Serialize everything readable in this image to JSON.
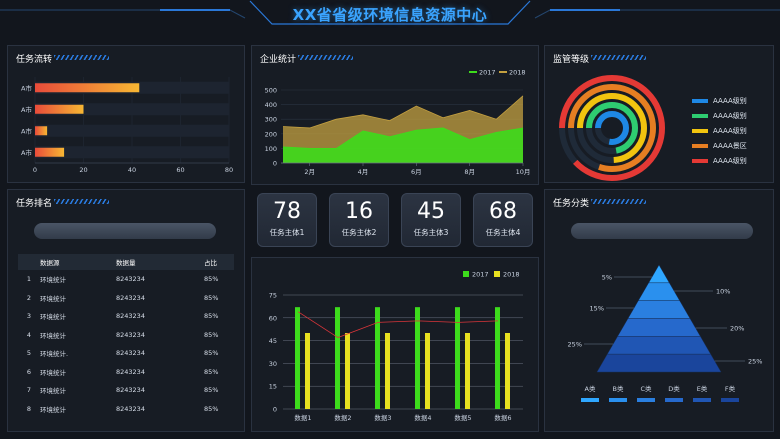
{
  "header": {
    "title": "XX省省级环境信息资源中心"
  },
  "task_flow": {
    "title": "任务流转",
    "chart_data": {
      "type": "bar",
      "orientation": "horizontal",
      "categories": [
        "A市",
        "A市",
        "A市",
        "A市"
      ],
      "values": [
        43,
        20,
        5,
        12
      ],
      "xlim": [
        0,
        80
      ],
      "xticks": [
        "0",
        "20",
        "40",
        "60",
        "80"
      ]
    }
  },
  "enterprise_stats": {
    "title": "企业统计",
    "chart_data": {
      "type": "area",
      "x": [
        "2月",
        "4月",
        "6月",
        "8月",
        "10月"
      ],
      "ylim": [
        0,
        500
      ],
      "yticks": [
        "0",
        "100",
        "200",
        "300",
        "400",
        "500"
      ],
      "series": [
        {
          "name": "2017",
          "color": "#3ddc1c",
          "values": [
            110,
            100,
            100,
            220,
            180,
            225,
            240,
            160,
            210,
            240
          ]
        },
        {
          "name": "2018",
          "color": "#c4a040",
          "values": [
            250,
            240,
            300,
            330,
            290,
            390,
            310,
            360,
            300,
            460
          ]
        }
      ]
    }
  },
  "supervision_level": {
    "title": "监管等级",
    "chart_data": {
      "type": "radial",
      "series": [
        {
          "name": "AAAA级别",
          "color": "#1e88e5",
          "value": 0.78
        },
        {
          "name": "AAAA级别",
          "color": "#2ecc71",
          "value": 0.72
        },
        {
          "name": "AAAA级别",
          "color": "#f1c40f",
          "value": 0.74
        },
        {
          "name": "AAAA景区",
          "color": "#e67e22",
          "value": 0.8
        },
        {
          "name": "AAAA级别",
          "color": "#e53935",
          "value": 0.88
        }
      ]
    }
  },
  "task_rank": {
    "title": "任务排名",
    "columns": [
      "",
      "数据源",
      "数据量",
      "占比"
    ],
    "rows": [
      [
        "1",
        "环境统计",
        "8243234",
        "85%"
      ],
      [
        "2",
        "环境统计",
        "8243234",
        "85%"
      ],
      [
        "3",
        "环境统计",
        "8243234",
        "85%"
      ],
      [
        "4",
        "环境统计",
        "8243234",
        "85%"
      ],
      [
        "5",
        "环境统计.",
        "8243234",
        "85%"
      ],
      [
        "6",
        "环境统计",
        "8243234",
        "85%"
      ],
      [
        "7",
        "环境统计",
        "8243234",
        "85%"
      ],
      [
        "8",
        "环境统计",
        "8243234",
        "85%"
      ]
    ]
  },
  "stats": [
    {
      "value": "78",
      "label": "任务主体1"
    },
    {
      "value": "16",
      "label": "任务主体2"
    },
    {
      "value": "45",
      "label": "任务主体3"
    },
    {
      "value": "68",
      "label": "任务主体4"
    }
  ],
  "grouped_chart": {
    "chart_data": {
      "type": "bar",
      "categories": [
        "数据1",
        "数据2",
        "数据3",
        "数据4",
        "数据5",
        "数据6"
      ],
      "ylim": [
        0,
        75
      ],
      "yticks": [
        "0",
        "15",
        "30",
        "45",
        "60",
        "75"
      ],
      "series": [
        {
          "name": "2017",
          "color": "#3ddc1c",
          "values": [
            67,
            67,
            67,
            67,
            67,
            67
          ]
        },
        {
          "name": "2018",
          "color": "#e8e020",
          "values": [
            50,
            50,
            50,
            50,
            50,
            50
          ]
        }
      ],
      "line": [
        64,
        47,
        57,
        58,
        57,
        58
      ]
    }
  },
  "task_category": {
    "title": "任务分类",
    "chart_data": {
      "type": "pyramid",
      "levels": [
        "5%",
        "10%",
        "15%",
        "20%",
        "25%",
        "25%"
      ],
      "categories": [
        "A类",
        "B类",
        "C类",
        "D类",
        "E类",
        "F类"
      ]
    }
  }
}
